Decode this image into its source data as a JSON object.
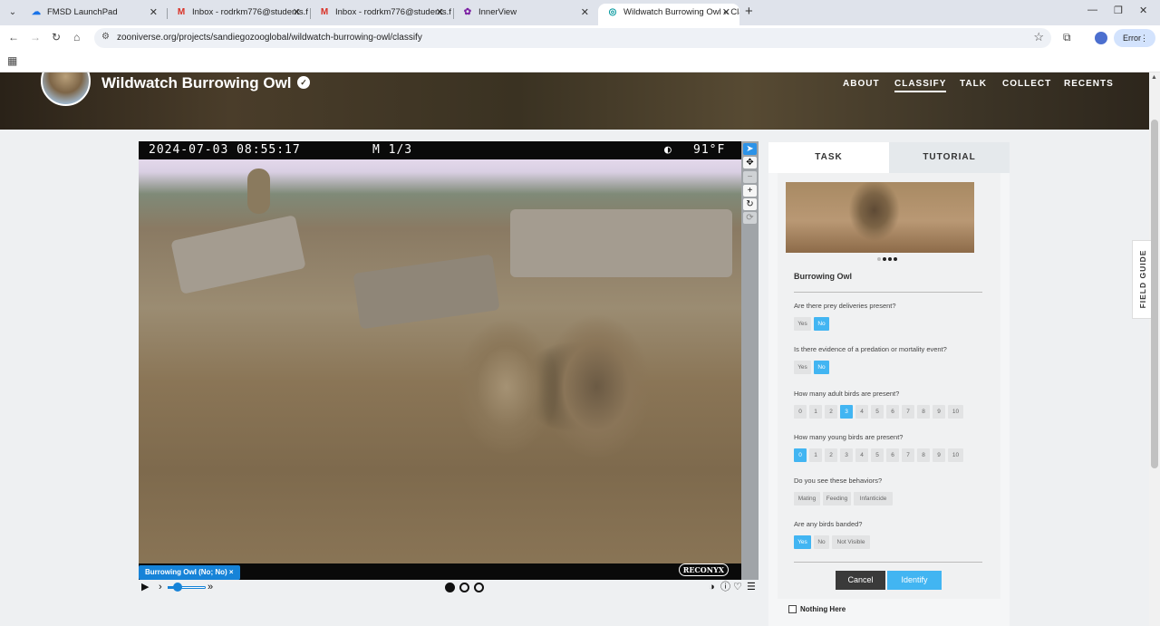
{
  "browser": {
    "tabs": [
      {
        "label": "FMSD LaunchPad",
        "icon": "cloud-icon"
      },
      {
        "label": "Inbox - rodrkm776@students.f",
        "icon": "gmail-icon"
      },
      {
        "label": "Inbox - rodrkm776@students.f",
        "icon": "gmail-icon"
      },
      {
        "label": "InnerView",
        "icon": "innerview-icon"
      },
      {
        "label": "Wildwatch Burrowing Owl « Cla",
        "icon": "zooniverse-icon"
      }
    ],
    "url": "zooniverse.org/projects/sandiegozooglobal/wildwatch-burrowing-owl/classify",
    "error_label": "Error"
  },
  "project": {
    "title": "Wildwatch Burrowing Owl",
    "nav": [
      "ABOUT",
      "CLASSIFY",
      "TALK",
      "COLLECT",
      "RECENTS"
    ],
    "active_nav": "CLASSIFY"
  },
  "subject": {
    "timestamp": "2024-07-03  08:55:17",
    "frame_label": "M 1/3",
    "temperature": "91°F",
    "moon_glyph": "◐",
    "camera_brand": "RECONYX",
    "annotation_tag": "Burrowing Owl (No; No)  ×",
    "frame_count": 3,
    "current_frame": 1
  },
  "panel": {
    "tabs": [
      "TASK",
      "TUTORIAL"
    ],
    "active_tab": "TASK",
    "species": "Burrowing Owl",
    "questions": [
      {
        "text": "Are there prey deliveries present?",
        "options": [
          "Yes",
          "No"
        ],
        "selected": [
          "No"
        ]
      },
      {
        "text": "Is there evidence of a predation or mortality event?",
        "options": [
          "Yes",
          "No"
        ],
        "selected": [
          "No"
        ]
      },
      {
        "text": "How many adult birds are present?",
        "options": [
          "0",
          "1",
          "2",
          "3",
          "4",
          "5",
          "6",
          "7",
          "8",
          "9",
          "10"
        ],
        "selected": [
          "3"
        ]
      },
      {
        "text": "How many young birds are present?",
        "options": [
          "0",
          "1",
          "2",
          "3",
          "4",
          "5",
          "6",
          "7",
          "8",
          "9",
          "10"
        ],
        "selected": [
          "0"
        ]
      },
      {
        "text": "Do you see these behaviors?",
        "options": [
          "Mating",
          "Feeding",
          "Infanticide"
        ],
        "selected": []
      },
      {
        "text": "Are any birds banded?",
        "options": [
          "Yes",
          "No",
          "Not Visible"
        ],
        "selected": [
          "Yes"
        ]
      }
    ],
    "cancel_label": "Cancel",
    "identify_label": "Identify",
    "nothing_here_label": "Nothing Here"
  },
  "field_guide_label": "FIELD GUIDE",
  "colors": {
    "accent": "#42b5f2",
    "tag": "#1683d8"
  }
}
